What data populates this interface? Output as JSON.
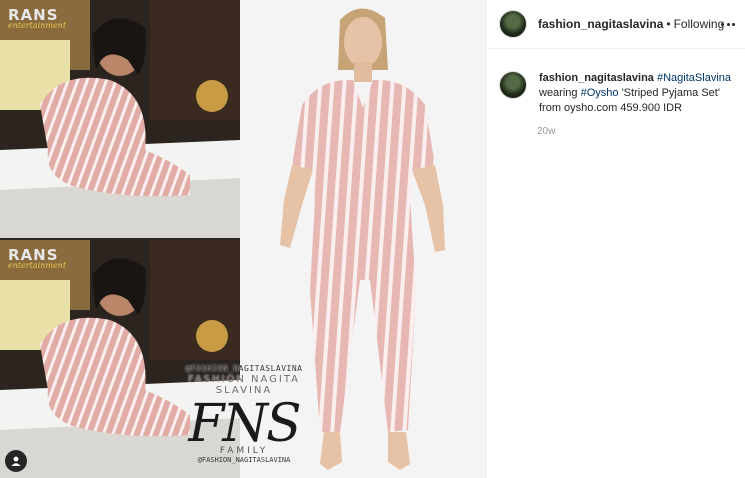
{
  "post": {
    "collage": {
      "logo": {
        "brand": "RANS",
        "sub": "entertainment"
      },
      "watermark": {
        "handle_top": "@FASHION_NAGITASLAVINA",
        "brand": "FASHION NAGITA SLAVINA",
        "monogram": "FNS",
        "family": "FAMILY",
        "handle_bottom": "@FASHION_NAGITASLAVINA"
      }
    }
  },
  "header": {
    "username": "fashion_nagitaslavina",
    "separator": "•",
    "follow_status": "Following"
  },
  "caption": {
    "username": "fashion_nagitaslavina",
    "hashtag1": "#NagitaSlavina",
    "text1": "wearing",
    "hashtag2": "#Oysho",
    "text2": "'Striped Pyjama Set' from oysho.com 459.900 IDR"
  },
  "timestamp": "20w",
  "colors": {
    "link": "#003569",
    "pajama_pink": "#e7b8b3",
    "stripe": "#fbeeee"
  }
}
